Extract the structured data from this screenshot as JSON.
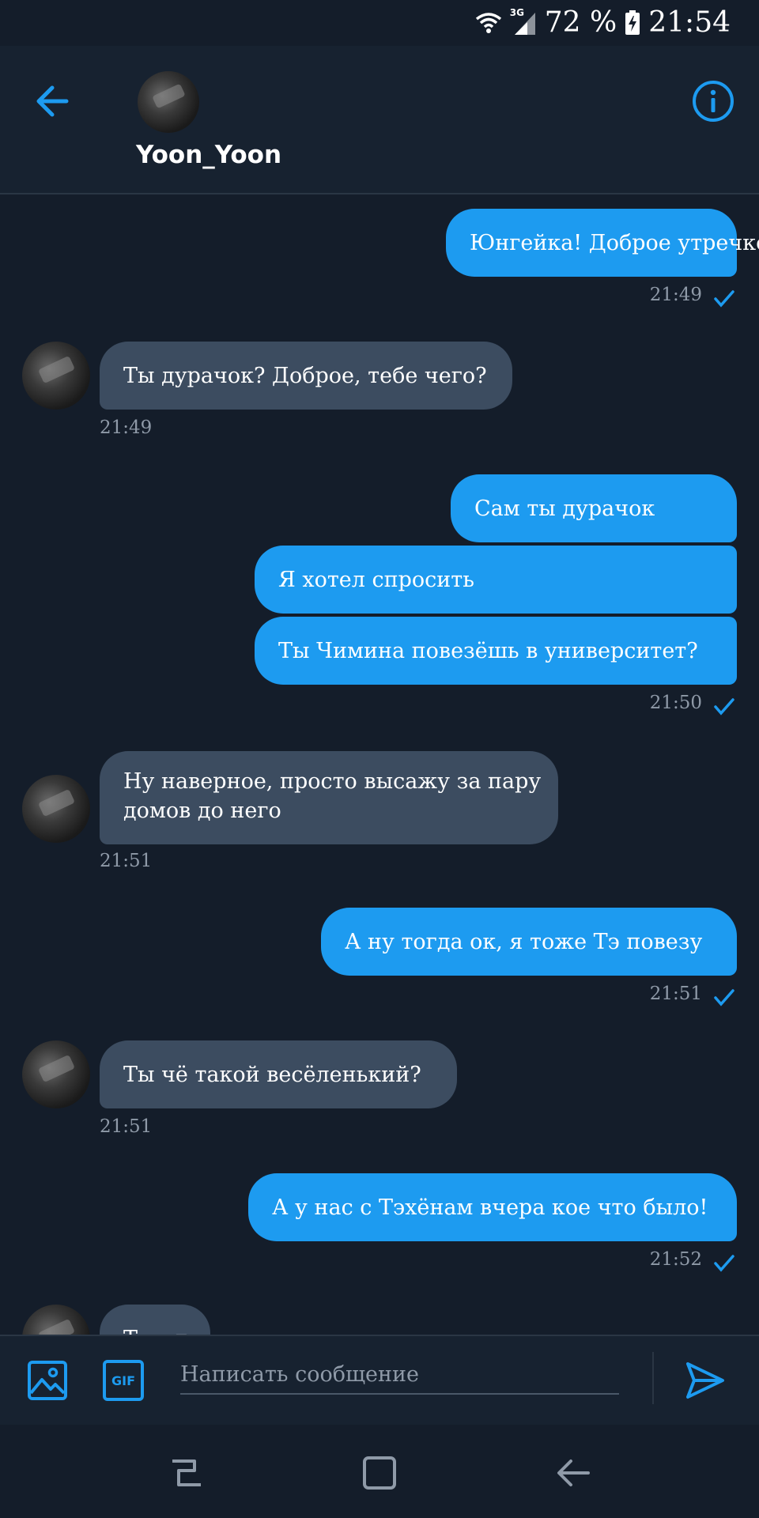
{
  "status_bar": {
    "network": "3G",
    "battery": "72 %",
    "time": "21:54"
  },
  "header": {
    "username": "Yoon_Yoon"
  },
  "messages": [
    {
      "dir": "out",
      "text": "Юнгейка! Доброе утречко!",
      "time": "21:49"
    },
    {
      "dir": "in",
      "text": "Ты дурачок? Доброе, тебе чего?",
      "time": "21:49"
    },
    {
      "dir": "out",
      "text": "Сам ты дурачок"
    },
    {
      "dir": "out",
      "text": "Я хотел спросить"
    },
    {
      "dir": "out",
      "text": "Ты Чимина повезёшь в университет?",
      "time": "21:50"
    },
    {
      "dir": "in",
      "line1": "Ну наверное, просто высажу за пару",
      "line2": "домов до него",
      "time": "21:51"
    },
    {
      "dir": "out",
      "text": "А ну тогда ок, я тоже Тэ повезу",
      "time": "21:51"
    },
    {
      "dir": "in",
      "text": "Ты чё такой весёленький?",
      "time": "21:51"
    },
    {
      "dir": "out",
      "text": "А у нас с Тэхёнам вчера кое что было!",
      "time": "21:52"
    },
    {
      "dir": "in",
      "text": "Ты чт"
    }
  ],
  "composer": {
    "placeholder": "Написать сообщение",
    "gif_label": "GIF"
  },
  "colors": {
    "background": "#141d2a",
    "outgoing": "#1d9bf0",
    "incoming": "#3c4c60",
    "accent": "#1d9bf0"
  },
  "icons": {
    "back": "arrow-left-icon",
    "info": "info-icon",
    "image": "image-icon",
    "gif": "gif-icon",
    "send": "send-icon",
    "read": "checkmark-icon",
    "nav_recent": "recent-apps-icon",
    "nav_home": "home-icon",
    "nav_back": "nav-back-icon"
  }
}
